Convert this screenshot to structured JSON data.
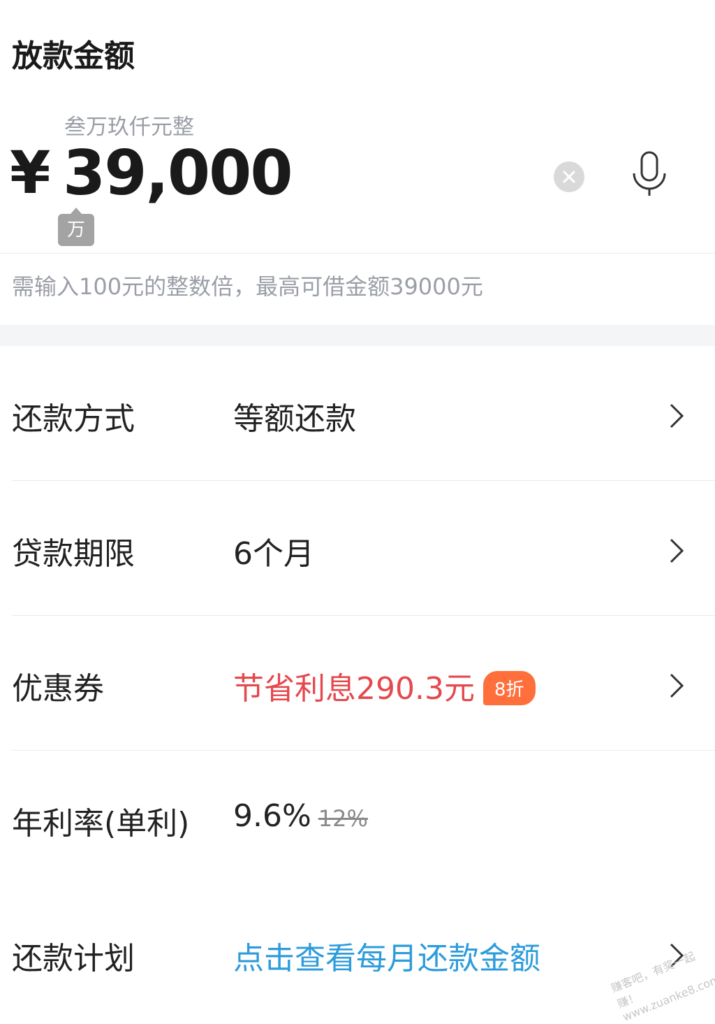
{
  "header": {
    "title": "放款金额"
  },
  "amount": {
    "words": "叁万玖仟元整",
    "currency_symbol": "¥",
    "value": "39,000",
    "unit_tip": "万"
  },
  "hint": "需输入100元的整数倍，最高可借金额39000元",
  "rows": [
    {
      "label": "还款方式",
      "value": "等额还款"
    },
    {
      "label": "贷款期限",
      "value": "6个月"
    },
    {
      "label": "优惠券",
      "value": "节省利息290.3元",
      "badge": "8折"
    },
    {
      "label": "年利率(单利)",
      "value": "9.6%",
      "original": "12%"
    },
    {
      "label": "还款计划",
      "value": "点击查看每月还款金额"
    }
  ],
  "watermark": "赚客吧，有奖一起赚！www.zuanke8.com",
  "colors": {
    "accent_red": "#e5484d",
    "accent_blue": "#2d9cdb",
    "badge_orange": "#ff6f3c"
  }
}
